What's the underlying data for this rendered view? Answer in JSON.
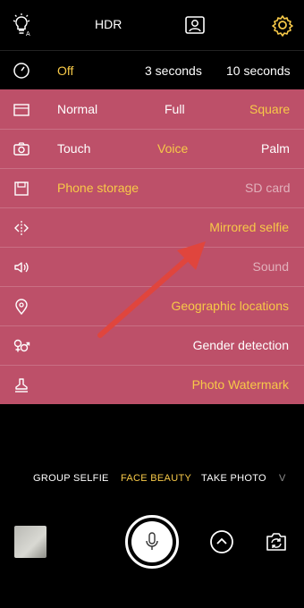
{
  "topbar": {
    "hdr_label": "HDR",
    "icons": [
      "bulb-auto-icon",
      "portrait-frame-icon",
      "gear-icon"
    ],
    "accent_color": "#f7c948"
  },
  "timer": {
    "options": [
      "Off",
      "3 seconds",
      "10 seconds"
    ],
    "selected": "Off"
  },
  "settings": {
    "background": "#bd5069",
    "rows": [
      {
        "icon": "aspect-ratio-icon",
        "options": [
          "Normal",
          "Full",
          "Square"
        ],
        "selected": "Square"
      },
      {
        "icon": "camera-icon",
        "options": [
          "Touch",
          "Voice",
          "Palm"
        ],
        "selected": "Voice"
      },
      {
        "icon": "storage-icon",
        "options": [
          "Phone storage",
          "SD card"
        ],
        "selected": "Phone storage"
      },
      {
        "icon": "mirror-icon",
        "label": "Mirrored selfie",
        "state": "on"
      },
      {
        "icon": "speaker-icon",
        "label": "Sound",
        "state": "off"
      },
      {
        "icon": "location-pin-icon",
        "label": "Geographic locations",
        "state": "on"
      },
      {
        "icon": "gender-icon",
        "label": "Gender detection",
        "state": "neutral"
      },
      {
        "icon": "stamp-icon",
        "label": "Photo Watermark",
        "state": "on"
      }
    ]
  },
  "modes": {
    "items": [
      "GROUP SELFIE",
      "FACE BEAUTY",
      "TAKE PHOTO",
      "V"
    ],
    "selected": "FACE BEAUTY"
  },
  "bottom": {
    "icons": [
      "gallery-thumbnail",
      "microphone-shutter-icon",
      "expand-up-icon",
      "switch-camera-icon"
    ]
  }
}
